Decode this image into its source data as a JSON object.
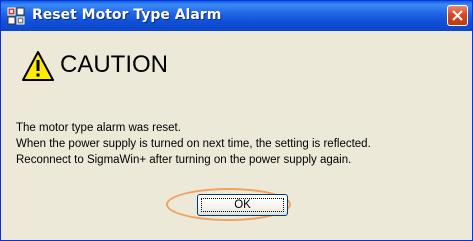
{
  "window": {
    "title": "Reset Motor Type Alarm",
    "icon": "sigma-app-icon",
    "close_icon": "close-icon"
  },
  "dialog": {
    "heading": "CAUTION",
    "heading_icon": "warning-triangle-icon",
    "message_lines": [
      "The motor type alarm was reset.",
      "When the power supply is turned on next time, the setting is reflected.",
      "Reconnect to SigmaWin+ after turning on the power supply again."
    ],
    "ok_label": "OK"
  },
  "colors": {
    "title_bar": "#0c47c8",
    "close_button": "#d9481d",
    "dialog_background": "#ece9d8",
    "highlight_ring": "#f0a060",
    "warning_yellow": "#ffeb00"
  }
}
